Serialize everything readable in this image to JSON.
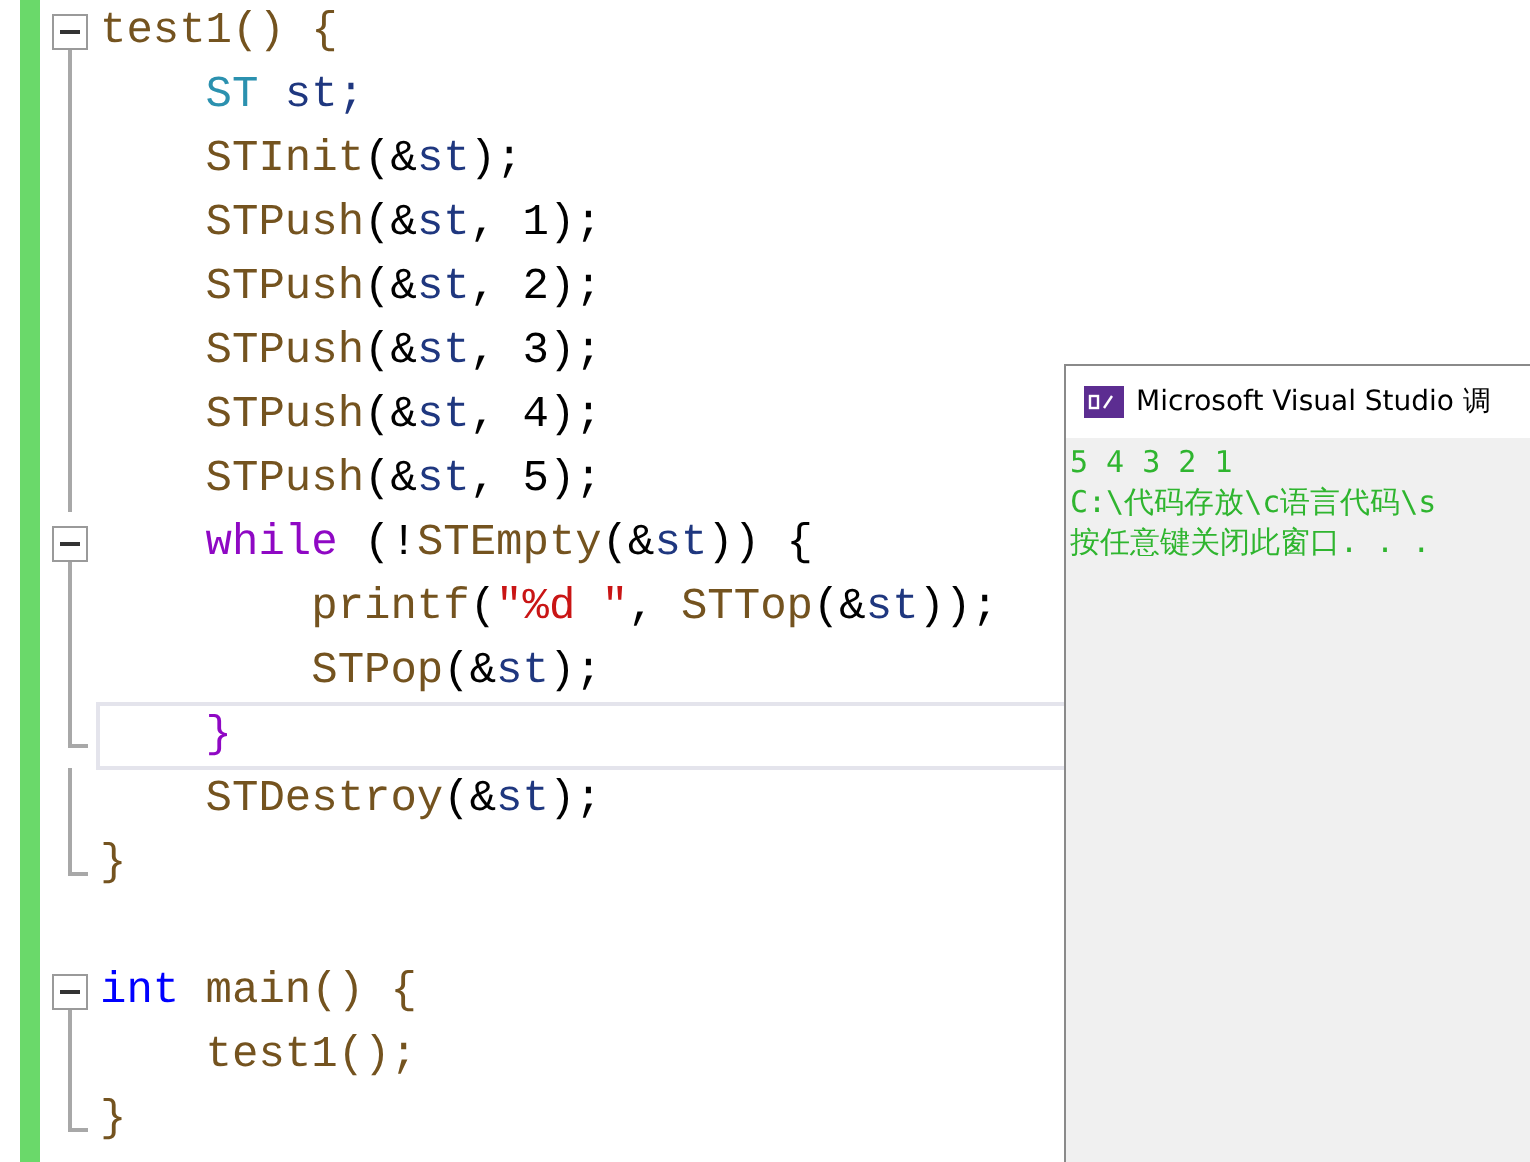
{
  "editor": {
    "lines": [
      {
        "collapsible": true,
        "tokens": [
          {
            "text": "test1() {",
            "kind": "func"
          }
        ]
      },
      {
        "tokens": [
          {
            "text": "    ST",
            "kind": "type"
          },
          {
            "text": " st;",
            "kind": "var"
          }
        ]
      },
      {
        "tokens": [
          {
            "text": "    STInit",
            "kind": "func"
          },
          {
            "text": "(&",
            "kind": "plain"
          },
          {
            "text": "st",
            "kind": "var"
          },
          {
            "text": ");",
            "kind": "plain"
          }
        ]
      },
      {
        "tokens": [
          {
            "text": "    STPush",
            "kind": "func"
          },
          {
            "text": "(&",
            "kind": "plain"
          },
          {
            "text": "st",
            "kind": "var"
          },
          {
            "text": ", 1);",
            "kind": "plain"
          }
        ]
      },
      {
        "tokens": [
          {
            "text": "    STPush",
            "kind": "func"
          },
          {
            "text": "(&",
            "kind": "plain"
          },
          {
            "text": "st",
            "kind": "var"
          },
          {
            "text": ", 2);",
            "kind": "plain"
          }
        ]
      },
      {
        "tokens": [
          {
            "text": "    STPush",
            "kind": "func"
          },
          {
            "text": "(&",
            "kind": "plain"
          },
          {
            "text": "st",
            "kind": "var"
          },
          {
            "text": ", 3);",
            "kind": "plain"
          }
        ]
      },
      {
        "tokens": [
          {
            "text": "    STPush",
            "kind": "func"
          },
          {
            "text": "(&",
            "kind": "plain"
          },
          {
            "text": "st",
            "kind": "var"
          },
          {
            "text": ", 4);",
            "kind": "plain"
          }
        ]
      },
      {
        "tokens": [
          {
            "text": "    STPush",
            "kind": "func"
          },
          {
            "text": "(&",
            "kind": "plain"
          },
          {
            "text": "st",
            "kind": "var"
          },
          {
            "text": ", 5);",
            "kind": "plain"
          }
        ]
      },
      {
        "collapsible": true,
        "tokens": [
          {
            "text": "    while",
            "kind": "control"
          },
          {
            "text": " (!",
            "kind": "plain"
          },
          {
            "text": "STEmpty",
            "kind": "func"
          },
          {
            "text": "(&",
            "kind": "plain"
          },
          {
            "text": "st",
            "kind": "var"
          },
          {
            "text": ")) {",
            "kind": "plain"
          }
        ]
      },
      {
        "tokens": [
          {
            "text": "        printf",
            "kind": "func"
          },
          {
            "text": "(",
            "kind": "plain"
          },
          {
            "text": "\"%d \"",
            "kind": "string"
          },
          {
            "text": ", ",
            "kind": "plain"
          },
          {
            "text": "STTop",
            "kind": "func"
          },
          {
            "text": "(&",
            "kind": "plain"
          },
          {
            "text": "st",
            "kind": "var"
          },
          {
            "text": "));",
            "kind": "plain"
          }
        ]
      },
      {
        "tokens": [
          {
            "text": "        STPop",
            "kind": "func"
          },
          {
            "text": "(&",
            "kind": "plain"
          },
          {
            "text": "st",
            "kind": "var"
          },
          {
            "text": ");",
            "kind": "plain"
          }
        ]
      },
      {
        "block_end": true,
        "current": true,
        "tokens": [
          {
            "text": "    }",
            "kind": "control"
          }
        ]
      },
      {
        "tokens": [
          {
            "text": "    STDestroy",
            "kind": "func"
          },
          {
            "text": "(&",
            "kind": "plain"
          },
          {
            "text": "st",
            "kind": "var"
          },
          {
            "text": ");",
            "kind": "plain"
          }
        ]
      },
      {
        "block_end": true,
        "tokens": [
          {
            "text": "}",
            "kind": "func"
          }
        ]
      },
      {
        "collapsible": true,
        "space_before": true,
        "tokens": [
          {
            "text": "int",
            "kind": "keyword"
          },
          {
            "text": " main() {",
            "kind": "func"
          }
        ]
      },
      {
        "tokens": [
          {
            "text": "    test1();",
            "kind": "func"
          }
        ]
      },
      {
        "block_end": true,
        "tokens": [
          {
            "text": "}",
            "kind": "func"
          }
        ]
      }
    ]
  },
  "console": {
    "title": "Microsoft Visual Studio 调",
    "lines": [
      "5 4 3 2 1",
      "C:\\代码存放\\c语言代码\\s",
      "按任意键关闭此窗口. . ."
    ]
  }
}
